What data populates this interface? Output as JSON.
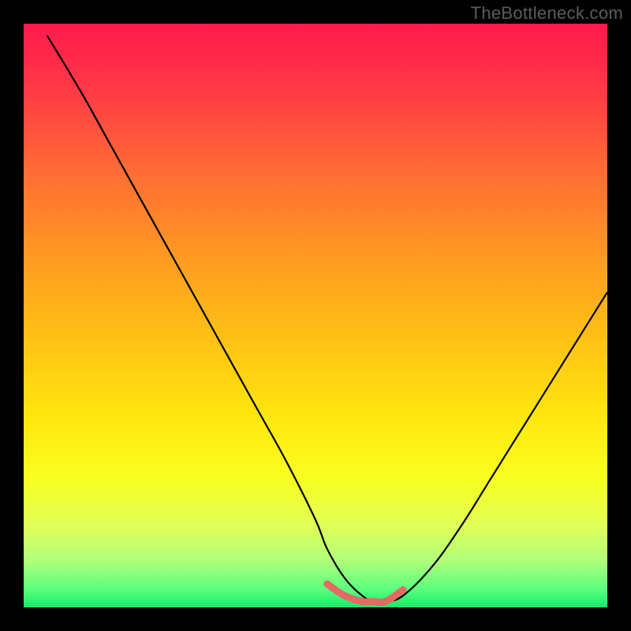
{
  "watermark": "TheBottleneck.com",
  "chart_data": {
    "type": "line",
    "title": "",
    "xlabel": "",
    "ylabel": "",
    "xlim": [
      0,
      100
    ],
    "ylim": [
      0,
      100
    ],
    "series": [
      {
        "name": "bottleneck-curve",
        "x": [
          4,
          10,
          15,
          20,
          25,
          30,
          35,
          40,
          45,
          50,
          52,
          55,
          58,
          60,
          62,
          65,
          70,
          75,
          80,
          85,
          90,
          95,
          100
        ],
        "y": [
          98,
          88,
          79,
          70,
          61,
          52,
          43,
          34,
          25,
          15,
          10,
          5,
          2,
          1,
          1,
          2,
          7,
          14,
          22,
          30,
          38,
          46,
          54
        ]
      },
      {
        "name": "optimal-band",
        "x": [
          52,
          55,
          58,
          60,
          62,
          65
        ],
        "y": [
          4,
          2,
          1,
          1,
          1,
          3
        ]
      }
    ],
    "background_gradient": {
      "stops": [
        {
          "offset": 0.0,
          "color": "#ff1a4d"
        },
        {
          "offset": 0.1,
          "color": "#ff3547"
        },
        {
          "offset": 0.25,
          "color": "#ff6a35"
        },
        {
          "offset": 0.4,
          "color": "#ff9a22"
        },
        {
          "offset": 0.55,
          "color": "#ffc414"
        },
        {
          "offset": 0.68,
          "color": "#ffe80e"
        },
        {
          "offset": 0.78,
          "color": "#f8ff20"
        },
        {
          "offset": 0.86,
          "color": "#e0ff56"
        },
        {
          "offset": 0.92,
          "color": "#b0ff7a"
        },
        {
          "offset": 0.97,
          "color": "#5aff7e"
        },
        {
          "offset": 1.0,
          "color": "#17e86b"
        }
      ]
    },
    "colors": {
      "curve": "#000000",
      "optimal_band": "#e46a64",
      "frame": "#000000"
    }
  }
}
